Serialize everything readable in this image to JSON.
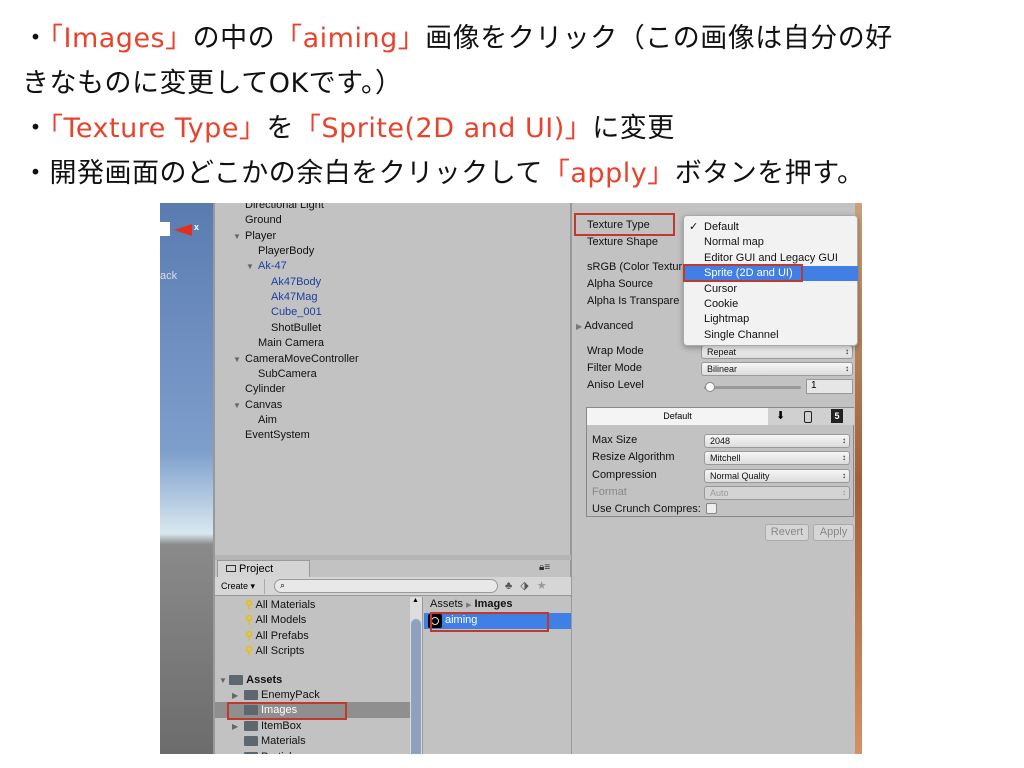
{
  "instructions": [
    {
      "pre": "・",
      "r1": "「Images」",
      "m1": "の中の",
      "r2": "「aiming」",
      "m2": "画像をクリック（この画像は自分の好"
    },
    {
      "text": "きなものに変更してOKです。）"
    },
    {
      "pre": "・",
      "r1": "「Texture Type」",
      "m1": "を",
      "r2": "「Sprite(2D and UI)」",
      "m2": "に変更"
    },
    {
      "pre": "・開発画面のどこかの余白をクリックして",
      "r1": "「apply」",
      "m1": "ボタンを押す。"
    }
  ],
  "scene": {
    "axis_label": "x",
    "persp": "ack"
  },
  "hierarchy": [
    "Directional Light",
    "Ground",
    "Player",
    "PlayerBody",
    "Ak-47",
    "Ak47Body",
    "Ak47Mag",
    "Cube_001",
    "ShotBullet",
    "Main Camera",
    "CameraMoveController",
    "SubCamera",
    "Cylinder",
    "Canvas",
    "Aim",
    "EventSystem"
  ],
  "inspector": {
    "labels": [
      "Texture Type",
      "Texture Shape",
      "sRGB (Color Textur",
      "Alpha Source",
      "Alpha Is Transpare",
      "Advanced",
      "Wrap Mode",
      "Filter Mode",
      "Aniso Level"
    ],
    "texture_type_menu": [
      "Default",
      "Normal map",
      "Editor GUI and Legacy GUI",
      "Sprite (2D and UI)",
      "Cursor",
      "Cookie",
      "Lightmap",
      "Single Channel"
    ],
    "menu_checked": "Default",
    "menu_highlighted": "Sprite (2D and UI)",
    "wrap_mode": "Repeat",
    "filter_mode": "Bilinear",
    "aniso_level": "1",
    "platform_tab": "Default",
    "platform_rows": [
      {
        "label": "Max Size",
        "value": "2048"
      },
      {
        "label": "Resize Algorithm",
        "value": "Mitchell"
      },
      {
        "label": "Compression",
        "value": "Normal Quality"
      },
      {
        "label": "Format",
        "value": "Auto"
      }
    ],
    "crunch_label": "Use Crunch Compres:",
    "revert": "Revert",
    "apply": "Apply"
  },
  "project": {
    "tab": "Project",
    "create": "Create ▾",
    "favorites": [
      "All Materials",
      "All Models",
      "All Prefabs",
      "All Scripts"
    ],
    "assets_root": "Assets",
    "folders": [
      "EnemyPack",
      "Images",
      "ItemBox",
      "Materials",
      "Particles"
    ],
    "breadcrumb": [
      "Assets",
      "Images"
    ],
    "files": [
      "aiming"
    ]
  }
}
